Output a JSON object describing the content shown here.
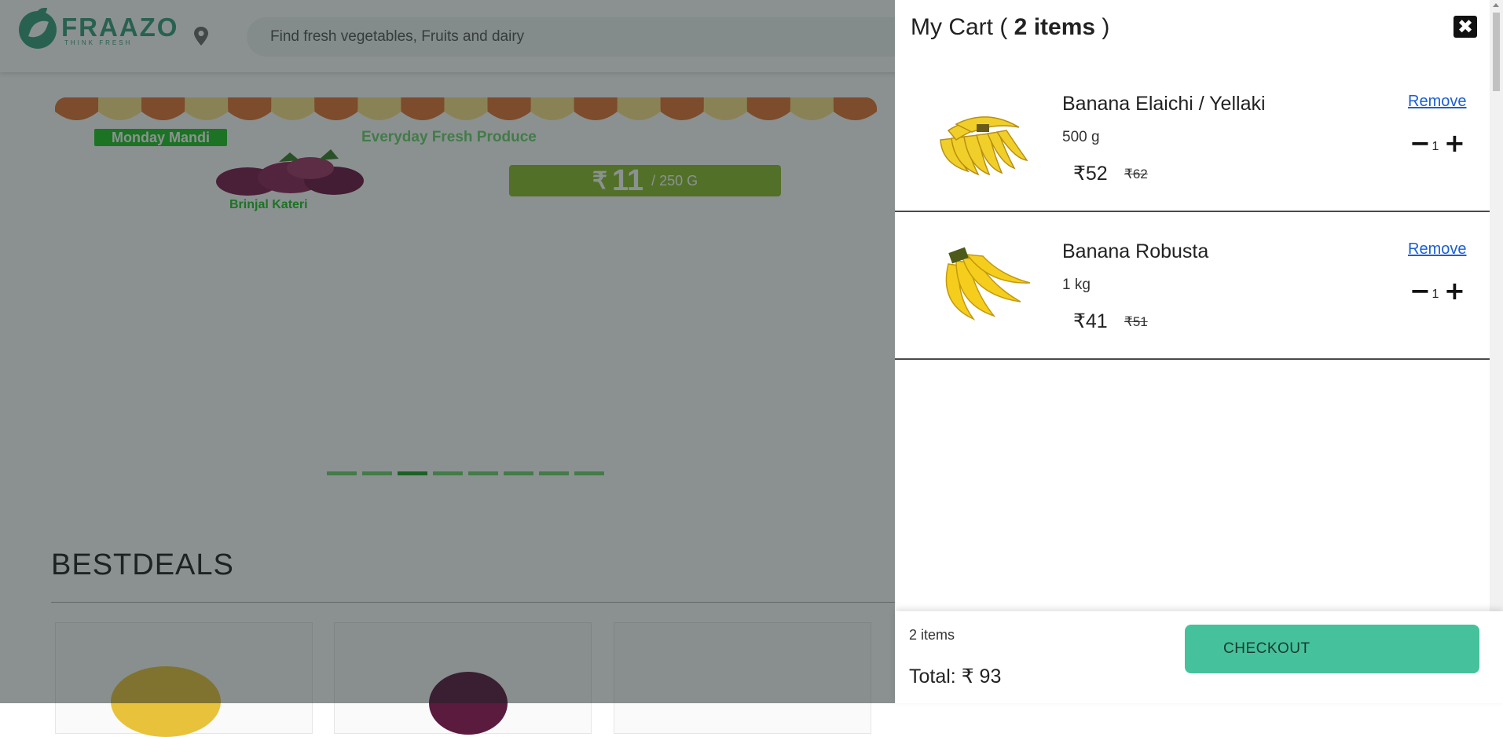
{
  "header": {
    "logo_name": "FRAAZO",
    "logo_tagline": "THINK FRESH",
    "search_placeholder": "Find fresh vegetables, Fruits and dairy"
  },
  "banner": {
    "tag": "Monday Mandi",
    "subtitle": "Everyday Fresh Produce",
    "product": "Brinjal Kateri",
    "price_symbol": "₹",
    "price": "11",
    "unit": "/ 250 G"
  },
  "carousel": {
    "prev_label": "‹",
    "next_label": "›",
    "slide_count": 8,
    "active_slide": 3
  },
  "bestdeals": {
    "title": "BESTDEALS"
  },
  "cart": {
    "title_prefix": "My Cart ( ",
    "title_count": "2 items",
    "title_suffix": " )",
    "close_label": "✖",
    "items": [
      {
        "name": "Banana Elaichi / Yellaki",
        "quantity": "500 g",
        "price": "₹52",
        "mrp": "₹62",
        "remove_label": "Remove",
        "count": "1",
        "minus_label": "−",
        "plus_label": "+"
      },
      {
        "name": "Banana Robusta",
        "quantity": "1 kg",
        "price": "₹41",
        "mrp": "₹51",
        "remove_label": "Remove",
        "count": "1",
        "minus_label": "−",
        "plus_label": "+"
      }
    ],
    "footer": {
      "item_count": "2 items",
      "total": "Total: ₹ 93",
      "checkout_label": "CHECKOUT"
    }
  },
  "colors": {
    "brand": "#3a9e7c",
    "checkout": "#45c29b",
    "remove_link": "#1a5fd6",
    "overlay": "rgba(24, 36, 36, 0.5)"
  }
}
